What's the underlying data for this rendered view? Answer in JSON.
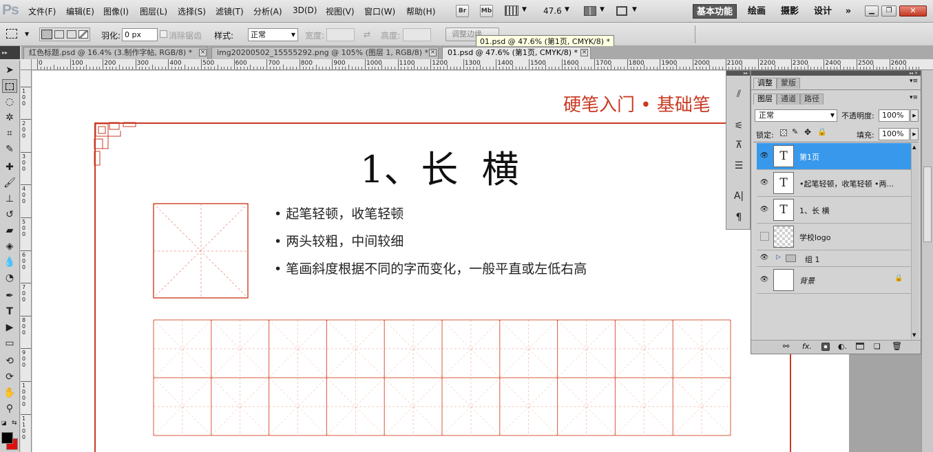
{
  "menubar": {
    "items": [
      "文件(F)",
      "编辑(E)",
      "图像(I)",
      "图层(L)",
      "选择(S)",
      "滤镜(T)",
      "分析(A)",
      "3D(D)",
      "视图(V)",
      "窗口(W)",
      "帮助(H)"
    ],
    "app_logo": "Ps",
    "bridge_label": "Br",
    "minibridge_label": "Mb",
    "zoom_value": "47.6",
    "workspaces": [
      "基本功能",
      "绘画",
      "摄影",
      "设计"
    ],
    "more": "»"
  },
  "options": {
    "feather_label": "羽化:",
    "feather_value": "0 px",
    "antialias_label": "消除锯齿",
    "style_label": "样式:",
    "style_value": "正常",
    "width_label": "宽度:",
    "height_label": "高度:",
    "refine_edge": "调整边缘..."
  },
  "tooltip": "01.psd @ 47.6% (第1页, CMYK/8) *",
  "tabs": [
    {
      "label": "红色标题.psd @ 16.4% (3.制作字帖, RGB/8) *",
      "active": false
    },
    {
      "label": "img20200502_15555292.png @ 105% (图层 1, RGB/8) *",
      "active": false
    },
    {
      "label": "01.psd @ 47.6% (第1页, CMYK/8) *",
      "active": true
    }
  ],
  "ruler": {
    "h_marks": [
      "0",
      "100",
      "200",
      "300",
      "400",
      "500",
      "600",
      "700",
      "800",
      "900",
      "1000",
      "1100",
      "1200",
      "1300",
      "1400",
      "1500",
      "1600",
      "1700",
      "1800",
      "1900",
      "2000",
      "2100",
      "2200",
      "2300",
      "2400",
      "2500",
      "2600"
    ],
    "v_marks": [
      "100",
      "200",
      "300",
      "400",
      "500",
      "600",
      "700",
      "800",
      "900",
      "1000",
      "1100"
    ]
  },
  "document": {
    "header": "硬笔入门 • 基础笔",
    "title": "1、长  横",
    "bullets": [
      "起笔轻顿，收笔轻顿",
      "两头较粗，中间较细",
      "笔画斜度根据不同的字而变化，一般平直或左低右高"
    ]
  },
  "panels": {
    "top_tabs": [
      "调整",
      "蒙版"
    ],
    "layer_tabs": [
      "图层",
      "通道",
      "路径"
    ],
    "blend_mode": "正常",
    "opacity_label": "不透明度:",
    "opacity_value": "100%",
    "lock_label": "锁定:",
    "fill_label": "填充:",
    "fill_value": "100%",
    "layers": [
      {
        "name": "第1页",
        "type": "text",
        "visible": true,
        "selected": true
      },
      {
        "name": "•起笔轻顿，收笔轻顿 •两...",
        "type": "text",
        "visible": true,
        "selected": false
      },
      {
        "name": "1、长 横",
        "type": "text",
        "visible": true,
        "selected": false
      },
      {
        "name": "学校logo",
        "type": "image",
        "visible": false,
        "selected": false
      },
      {
        "name": "组 1",
        "type": "group",
        "visible": true,
        "selected": false
      },
      {
        "name": "背景",
        "type": "background",
        "visible": true,
        "selected": false
      }
    ]
  },
  "colors": {
    "accent_red": "#c83a22",
    "selection_blue": "#3899ec"
  }
}
